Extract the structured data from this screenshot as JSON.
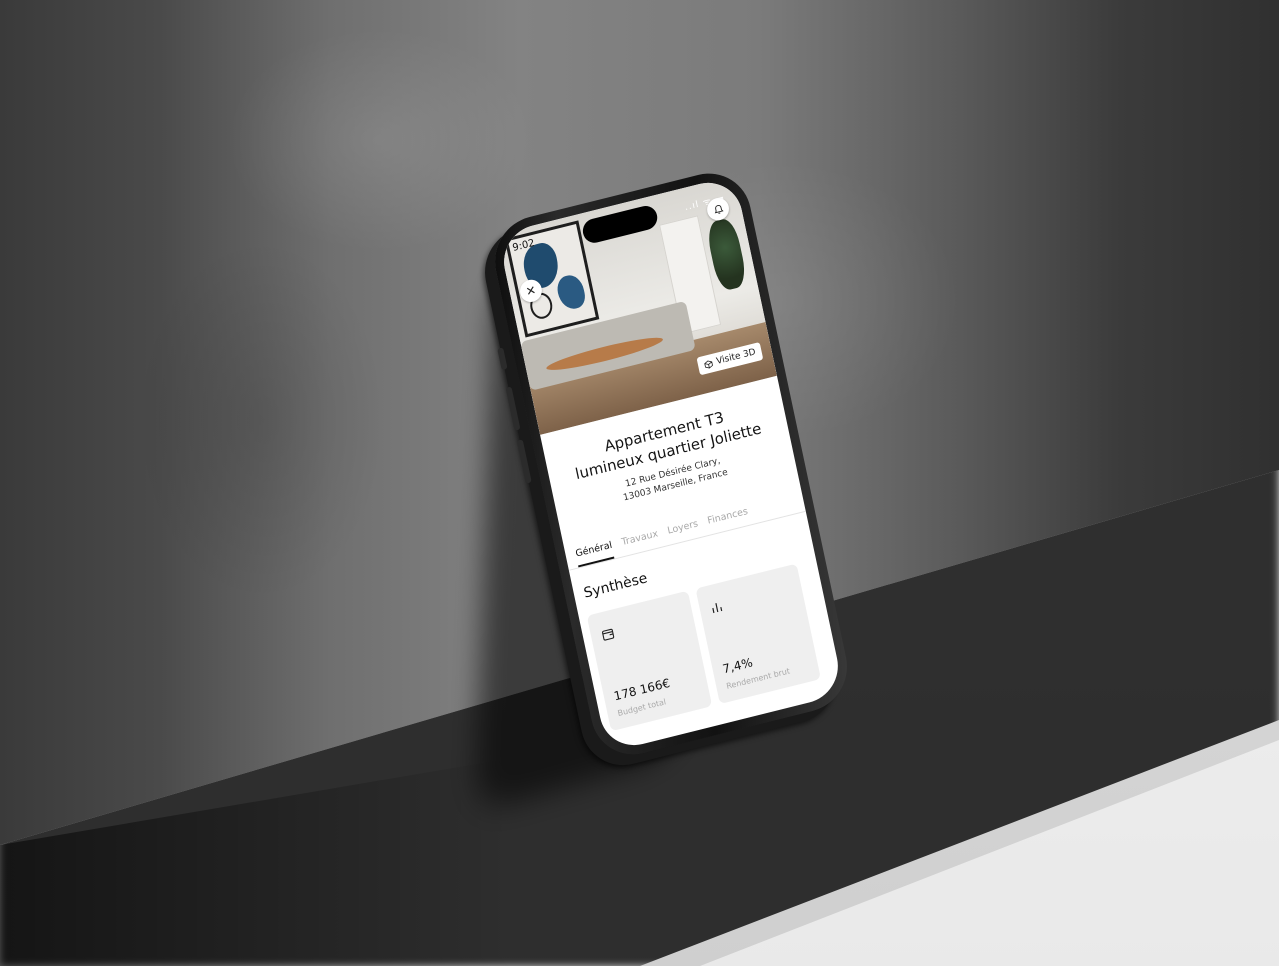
{
  "status": {
    "time": "9:02",
    "signal": "..ıl ᯤ ▬"
  },
  "hero": {
    "visit_label": "Visite 3D"
  },
  "property": {
    "title_line1": "Appartement T3",
    "title_line2": "lumineux quartier Joliette",
    "address_line1": "12 Rue Désirée Clary,",
    "address_line2": "13003 Marseille, France"
  },
  "tabs": [
    {
      "label": "Général",
      "active": true
    },
    {
      "label": "Travaux",
      "active": false
    },
    {
      "label": "Loyers",
      "active": false
    },
    {
      "label": "Finances",
      "active": false
    }
  ],
  "synthese": {
    "title": "Synthèse",
    "cards": [
      {
        "icon": "wallet-icon",
        "value": "178 166€",
        "label": "Budget total"
      },
      {
        "icon": "bar-chart-icon",
        "value": "7,4%",
        "label": "Rendement brut"
      }
    ]
  },
  "colors": {
    "accent": "#111111",
    "card_bg": "#efefef",
    "tab_inactive": "#a9a9a9"
  }
}
